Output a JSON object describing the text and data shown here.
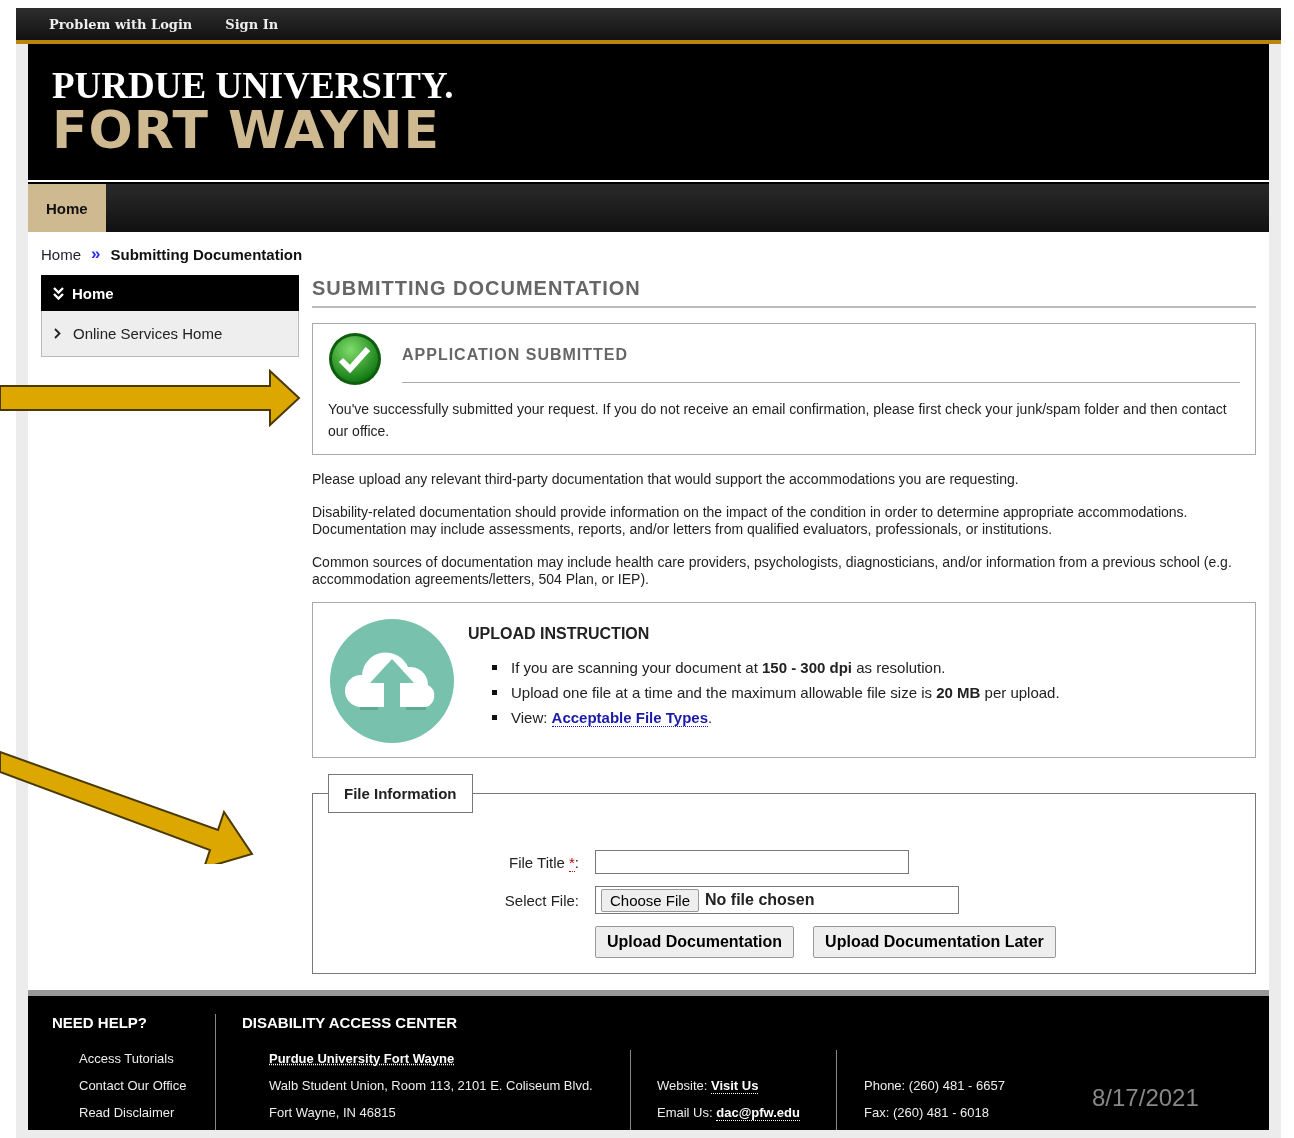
{
  "top_links": [
    {
      "label": "Problem with Login"
    },
    {
      "label": "Sign In"
    }
  ],
  "logo": {
    "line1": "PURDUE UNIVERSITY.",
    "line2": "FORT WAYNE"
  },
  "nav": [
    {
      "label": "Home",
      "selected": true
    }
  ],
  "breadcrumb": {
    "items": [
      "Home",
      "Submitting Documentation"
    ],
    "separator": "»"
  },
  "sidebar": {
    "heading": "Home",
    "items": [
      {
        "label": "Online Services Home"
      }
    ]
  },
  "page_title": "SUBMITTING DOCUMENTATION",
  "alert": {
    "title": "APPLICATION SUBMITTED",
    "message": "You've successfully submitted your request. If you do not receive an email confirmation, please first check your junk/spam folder and then contact our office."
  },
  "paragraphs": [
    "Please upload any relevant third-party documentation that would support the accommodations you are requesting.",
    "Disability-related documentation should provide information on the impact of the condition in order to determine appropriate accommodations. Documentation may include assessments, reports, and/or letters from qualified evaluators, professionals, or institutions.",
    "Common sources of documentation may include health care providers, psychologists, diagnosticians, and/or information from a previous school (e.g. accommodation agreements/letters, 504 Plan, or IEP)."
  ],
  "upload": {
    "title": "UPLOAD INSTRUCTION",
    "bullets": [
      {
        "kind": "text",
        "text": "If you are scanning your document at **150 - 300 dpi** as resolution."
      },
      {
        "kind": "text",
        "text": "Upload one file at a time and the maximum allowable file size is **20 MB** per upload."
      },
      {
        "kind": "link",
        "prefix": "View: ",
        "link": "Acceptable File Types",
        "suffix": "."
      }
    ]
  },
  "file_info": {
    "legend": "File Information",
    "fields": [
      {
        "kind": "text",
        "label": "File Title",
        "required": true,
        "required_mark": "*",
        "colon": ":"
      },
      {
        "kind": "file",
        "label": "Select File:",
        "button": "Choose File",
        "status": "No file chosen"
      }
    ],
    "buttons": [
      "Upload Documentation",
      "Upload Documentation Later"
    ]
  },
  "footer": {
    "help": {
      "heading": "NEED HELP?",
      "links": [
        "Access Tutorials",
        "Contact Our Office",
        "Read Disclaimer"
      ]
    },
    "center": {
      "heading": "DISABILITY ACCESS CENTER",
      "name": "Purdue University Fort Wayne",
      "address": [
        "Walb Student Union, Room 113, 2101 E. Coliseum Blvd.",
        "Fort Wayne, IN 46815"
      ],
      "web": [
        {
          "label": "Website: ",
          "link": "Visit Us"
        },
        {
          "label": "Email Us: ",
          "link": "dac@pfw.edu"
        }
      ],
      "phones": [
        "Phone: (260) 481 - 6657",
        "Fax: (260) 481 - 6018"
      ]
    }
  },
  "date": "8/17/2021",
  "annotations": [
    {
      "kind": "arrow-right"
    },
    {
      "kind": "arrow-diagonal"
    }
  ]
}
